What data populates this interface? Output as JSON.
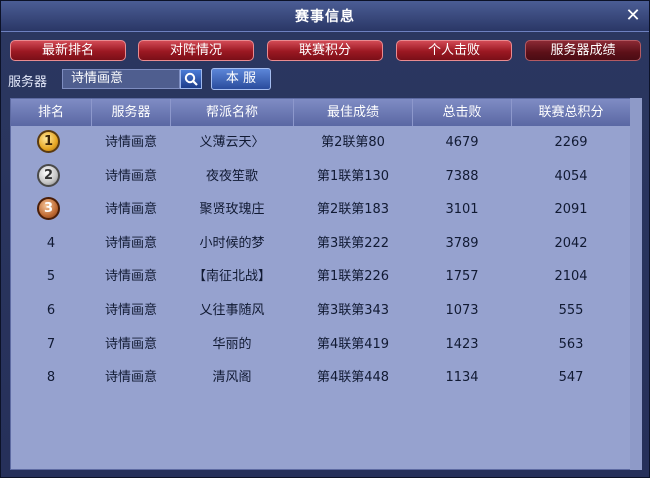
{
  "window": {
    "title": "赛事信息",
    "close_glyph": "✕"
  },
  "tabs": [
    {
      "label": "最新排名",
      "active": false
    },
    {
      "label": "对阵情况",
      "active": false
    },
    {
      "label": "联赛积分",
      "active": false
    },
    {
      "label": "个人击败",
      "active": false
    },
    {
      "label": "服务器成绩",
      "active": true
    }
  ],
  "server_filter": {
    "label": "服务器",
    "value": "诗情画意",
    "search_icon": "search-icon",
    "local_button": "本 服"
  },
  "table": {
    "columns": [
      "排名",
      "服务器",
      "帮派名称",
      "最佳成绩",
      "总击败",
      "联赛总积分"
    ],
    "rows": [
      {
        "rank": "1",
        "medal": "gold",
        "server": "诗情画意",
        "guild": "义薄云天〉",
        "best": "第2联第80",
        "kills": "4679",
        "points": "2269"
      },
      {
        "rank": "2",
        "medal": "silver",
        "server": "诗情画意",
        "guild": "夜夜笙歌",
        "best": "第1联第130",
        "kills": "7388",
        "points": "4054"
      },
      {
        "rank": "3",
        "medal": "bronze",
        "server": "诗情画意",
        "guild": "聚贤玫瑰庄",
        "best": "第2联第183",
        "kills": "3101",
        "points": "2091"
      },
      {
        "rank": "4",
        "medal": "",
        "server": "诗情画意",
        "guild": "小时候的梦",
        "best": "第3联第222",
        "kills": "3789",
        "points": "2042"
      },
      {
        "rank": "5",
        "medal": "",
        "server": "诗情画意",
        "guild": "【南征北战】",
        "best": "第1联第226",
        "kills": "1757",
        "points": "2104"
      },
      {
        "rank": "6",
        "medal": "",
        "server": "诗情画意",
        "guild": "乂往事随风",
        "best": "第3联第343",
        "kills": "1073",
        "points": "555"
      },
      {
        "rank": "7",
        "medal": "",
        "server": "诗情画意",
        "guild": "华丽的",
        "best": "第4联第419",
        "kills": "1423",
        "points": "563"
      },
      {
        "rank": "8",
        "medal": "",
        "server": "诗情画意",
        "guild": "清风阁",
        "best": "第4联第448",
        "kills": "1134",
        "points": "547"
      }
    ]
  },
  "colors": {
    "tab_red": "#9b1822",
    "header_blue": "#5a67a3",
    "table_bg": "#96a2cf"
  }
}
